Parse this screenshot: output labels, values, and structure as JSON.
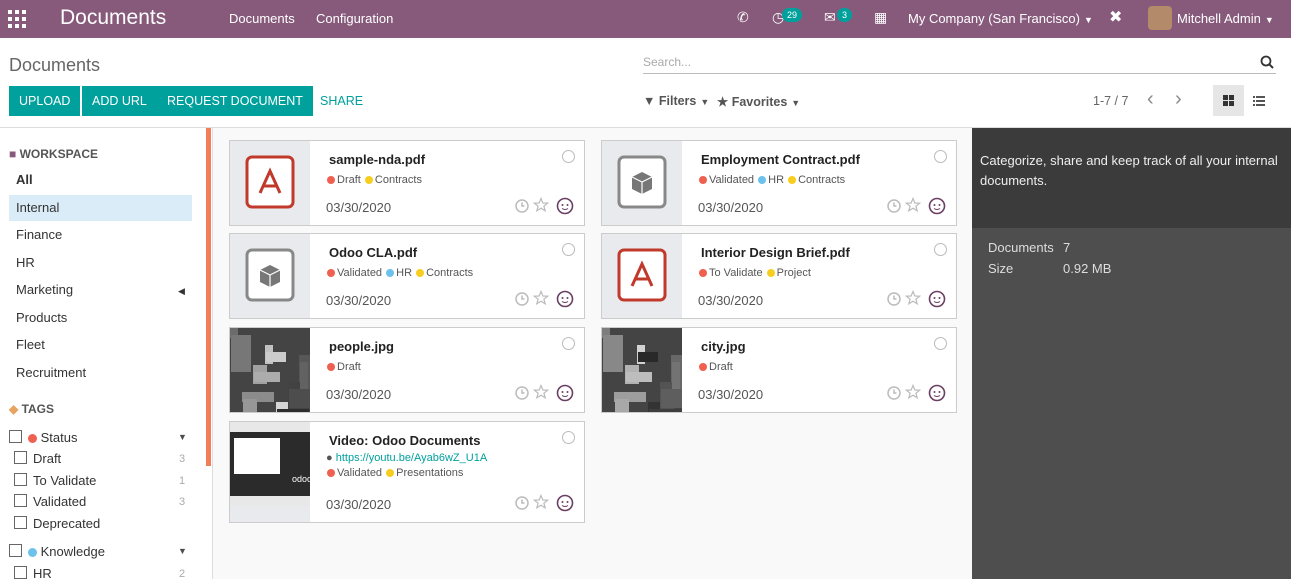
{
  "app": {
    "title": "Documents",
    "menu": [
      "Documents",
      "Configuration"
    ],
    "activity_count": "29",
    "message_count": "3",
    "company": "My Company (San Francisco)",
    "user": "Mitchell Admin"
  },
  "control": {
    "breadcrumb": "Documents",
    "buttons": [
      "UPLOAD",
      "ADD URL",
      "REQUEST DOCUMENT"
    ],
    "share": "SHARE",
    "search_placeholder": "Search...",
    "filters": "Filters",
    "favorites": "Favorites",
    "pager": "1-7 / 7"
  },
  "sidebar": {
    "workspace_title": "WORKSPACE",
    "workspaces": [
      "All",
      "Internal",
      "Finance",
      "HR",
      "Marketing",
      "Products",
      "Fleet",
      "Recruitment"
    ],
    "tags_title": "TAGS",
    "tag_groups": [
      {
        "name": "Status",
        "color": "#f06050",
        "tags": [
          {
            "label": "Draft",
            "count": "3"
          },
          {
            "label": "To Validate",
            "count": "1"
          },
          {
            "label": "Validated",
            "count": "3"
          },
          {
            "label": "Deprecated",
            "count": ""
          }
        ]
      },
      {
        "name": "Knowledge",
        "color": "#6cc1ed",
        "tags": [
          {
            "label": "HR",
            "count": "2"
          }
        ]
      }
    ]
  },
  "documents": [
    {
      "name": "sample-nda.pdf",
      "tags": [
        {
          "label": "Draft",
          "color": "#f06050"
        },
        {
          "label": "Contracts",
          "color": "#f7cd1f"
        }
      ],
      "date": "03/30/2020",
      "thumb": "pdf-icon"
    },
    {
      "name": "Employment Contract.pdf",
      "tags": [
        {
          "label": "Validated",
          "color": "#f06050"
        },
        {
          "label": "HR",
          "color": "#6cc1ed"
        },
        {
          "label": "Contracts",
          "color": "#f7cd1f"
        }
      ],
      "date": "03/30/2020",
      "thumb": "box-icon"
    },
    {
      "name": "Odoo CLA.pdf",
      "tags": [
        {
          "label": "Validated",
          "color": "#f06050"
        },
        {
          "label": "HR",
          "color": "#6cc1ed"
        },
        {
          "label": "Contracts",
          "color": "#f7cd1f"
        }
      ],
      "date": "03/30/2020",
      "thumb": "box-icon"
    },
    {
      "name": "Interior Design Brief.pdf",
      "tags": [
        {
          "label": "To Validate",
          "color": "#f06050"
        },
        {
          "label": "Project",
          "color": "#f7cd1f"
        }
      ],
      "date": "03/30/2020",
      "thumb": "pdf-icon"
    },
    {
      "name": "people.jpg",
      "tags": [
        {
          "label": "Draft",
          "color": "#f06050"
        }
      ],
      "date": "03/30/2020",
      "thumb": "photo"
    },
    {
      "name": "city.jpg",
      "tags": [
        {
          "label": "Draft",
          "color": "#f06050"
        }
      ],
      "date": "03/30/2020",
      "thumb": "photo"
    },
    {
      "name": "Video: Odoo Documents",
      "url": "https://youtu.be/Ayab6wZ_U1A",
      "tags": [
        {
          "label": "Validated",
          "color": "#f06050"
        },
        {
          "label": "Presentations",
          "color": "#f7cd1f"
        }
      ],
      "date": "03/30/2020",
      "thumb": "video"
    }
  ],
  "panel": {
    "description": "Categorize, share and keep track of all your internal documents.",
    "documents_label": "Documents",
    "documents_value": "7",
    "size_label": "Size",
    "size_value": "0.92 MB"
  }
}
